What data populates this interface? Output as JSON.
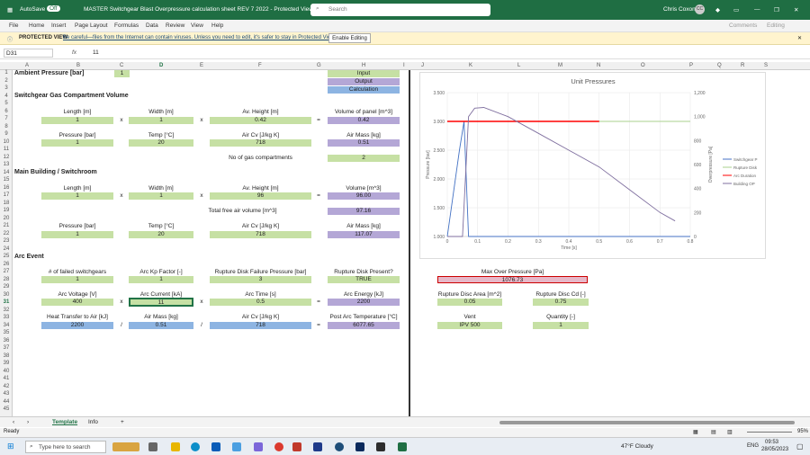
{
  "titlebar": {
    "autosave": "AutoSave",
    "autosave_state": "Off",
    "doc_title": "MASTER Switchgear Blast Overpressure calculation sheet REV 7 2022  -  Protected View",
    "search_placeholder": "Search",
    "user": "Chris Coxon",
    "user_initials": "CC"
  },
  "ribbon": {
    "tabs": [
      "File",
      "Home",
      "Insert",
      "Page Layout",
      "Formulas",
      "Data",
      "Review",
      "View",
      "Help"
    ],
    "comments": "Comments",
    "editing": "Editing"
  },
  "protected": {
    "label": "PROTECTED VIEW",
    "message": "Be careful—files from the Internet can contain viruses. Unless you need to edit, it's safer to stay in Protected View.",
    "button": "Enable Editing"
  },
  "formula_bar": {
    "namebox": "D31",
    "fx": "fx",
    "value": "11"
  },
  "columns": [
    "A",
    "B",
    "C",
    "D",
    "E",
    "F",
    "G",
    "H",
    "I",
    "J",
    "K",
    "L",
    "M",
    "N",
    "O",
    "P",
    "Q",
    "R",
    "S"
  ],
  "sheet": {
    "ambient_label": "Ambient Pressure [bar]",
    "ambient_value": "1",
    "legend_input": "Input",
    "legend_output": "Output",
    "legend_calc": "Calculation",
    "sec1": "Switchgear Gas Compartment Volume",
    "r6": [
      "Length [m]",
      "Width [m]",
      "Av. Height [m]",
      "Volume of panel [m^3]"
    ],
    "r7": [
      "1",
      "x",
      "1",
      "x",
      "0.42",
      "=",
      "0.42"
    ],
    "r9": [
      "Pressure [bar]",
      "Temp [°C]",
      "Air Cv [J/kg K]",
      "Air Mass [kg]"
    ],
    "r10": [
      "1",
      "20",
      "718",
      "0.51"
    ],
    "r12_label": "No of gas compartments",
    "r12_value": "2",
    "sec2": "Main Building / Switchroom",
    "r16": [
      "Length [m]",
      "Width [m]",
      "Av. Height [m]",
      "Volume [m^3]"
    ],
    "r17": [
      "1",
      "x",
      "1",
      "x",
      "96",
      "=",
      "96.00"
    ],
    "r19_label": "Total free air volume [m^3]",
    "r19_value": "97.16",
    "r21": [
      "Pressure [bar]",
      "Temp [°C]",
      "Air Cv [J/kg K]",
      "Air Mass [kg]"
    ],
    "r22": [
      "1",
      "20",
      "718",
      "117.07"
    ],
    "sec3": "Arc Event",
    "r27": [
      "# of failed switchgears",
      "Arc Kp Factor [-]",
      "Rupture Disk Failure Pressure [bar]",
      "Rupture Disk Present?"
    ],
    "r28": [
      "1",
      "1",
      "3",
      "TRUE"
    ],
    "r30": [
      "Arc Voltage [V]",
      "Arc Current [kA]",
      "Arc Time [s]",
      "Arc Energy [kJ]"
    ],
    "r31": [
      "400",
      "x",
      "11",
      "x",
      "0.5",
      "=",
      "2200"
    ],
    "r33": [
      "Heat Transfer to Air [kJ]",
      "Air Mass [kg]",
      "Air Cv [J/kg K]",
      "Post Arc Temperature [°C]"
    ],
    "r34": [
      "2200",
      "/",
      "0.51",
      "/",
      "718",
      "=",
      "6077.65"
    ],
    "maxop_label": "Max Over Pressure [Pa]",
    "maxop_value": "1076.73",
    "rda_label": "Rupture Disc Area [m^2]",
    "rda_value": "0.05",
    "rdcd_label": "Rupture Disc Cd [-]",
    "rdcd_value": "0.75",
    "vent_label": "Vent",
    "vent_value": "IPV 500",
    "qty_label": "Quantity [-]",
    "qty_value": "1"
  },
  "chart_data": {
    "type": "line",
    "title": "Unit Pressures",
    "xlabel": "Time [s]",
    "ylabel": "Pressure [bar]",
    "y2label": "Overpressure [Pa]",
    "x_ticks": [
      "0",
      "0.1",
      "0.2",
      "0.3",
      "0.4",
      "0.5",
      "0.6",
      "0.7",
      "0.8"
    ],
    "y_ticks": [
      "1.000",
      "1.500",
      "2.000",
      "2.500",
      "3.000",
      "3.500"
    ],
    "y2_ticks": [
      "0",
      "200",
      "400",
      "600",
      "800",
      "1,000",
      "1,200"
    ],
    "xlim": [
      0,
      0.8
    ],
    "ylim": [
      1,
      3.5
    ],
    "y2lim": [
      0,
      1200
    ],
    "series": [
      {
        "name": "Switchgear P",
        "color": "#4472c4",
        "axis": "y",
        "x": [
          0,
          0.04,
          0.055,
          0.07,
          0.2,
          0.4,
          0.8
        ],
        "y": [
          1,
          2.5,
          3.0,
          1.0,
          1.0,
          1.0,
          1.0
        ]
      },
      {
        "name": "Rupture Disk",
        "color": "#a9d18e",
        "axis": "y",
        "x": [
          0,
          0.8
        ],
        "y": [
          3.0,
          3.0
        ]
      },
      {
        "name": "Arc Duration",
        "color": "#ff0000",
        "axis": "y",
        "x": [
          0,
          0.5
        ],
        "y": [
          3.0,
          3.0
        ]
      },
      {
        "name": "Building OP",
        "color": "#7f6f9f",
        "axis": "y2",
        "x": [
          0,
          0.05,
          0.07,
          0.09,
          0.12,
          0.2,
          0.3,
          0.4,
          0.5,
          0.6,
          0.7,
          0.75
        ],
        "y": [
          0,
          0,
          1000,
          1070,
          1076,
          1000,
          860,
          720,
          580,
          390,
          200,
          130
        ]
      }
    ],
    "legend": "right"
  },
  "tabs": {
    "sheets": [
      "Template",
      "Info"
    ],
    "add": "+"
  },
  "status": {
    "ready": "Ready",
    "zoom": "95%"
  },
  "taskbar": {
    "search": "Type here to search",
    "weather": "47°F  Cloudy",
    "lang": "ENG",
    "time": "09:53",
    "date": "28/05/2023"
  }
}
